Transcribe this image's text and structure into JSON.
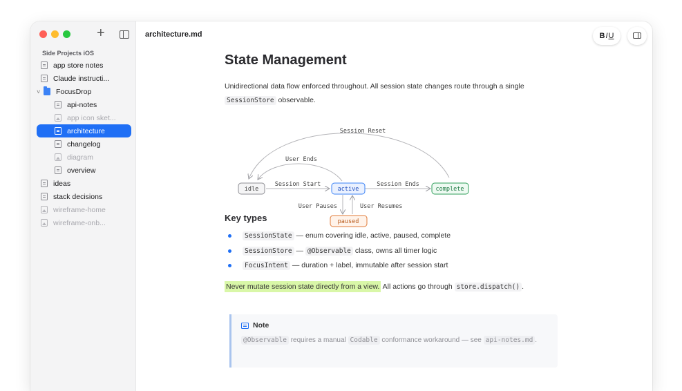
{
  "sidebar": {
    "section": "Side Projects iOS",
    "items": [
      {
        "label": "app store notes",
        "type": "doc",
        "indent": 0,
        "state": "normal"
      },
      {
        "label": "Claude instructi...",
        "type": "doc",
        "indent": 0,
        "state": "normal"
      },
      {
        "label": "FocusDrop",
        "type": "folder",
        "indent": 0,
        "state": "normal"
      },
      {
        "label": "api-notes",
        "type": "doc",
        "indent": 1,
        "state": "normal"
      },
      {
        "label": "app icon sket...",
        "type": "image",
        "indent": 1,
        "state": "dim"
      },
      {
        "label": "architecture",
        "type": "doc",
        "indent": 1,
        "state": "active"
      },
      {
        "label": "changelog",
        "type": "doc",
        "indent": 1,
        "state": "normal"
      },
      {
        "label": "diagram",
        "type": "image",
        "indent": 1,
        "state": "dim"
      },
      {
        "label": "overview",
        "type": "doc",
        "indent": 1,
        "state": "normal"
      },
      {
        "label": "ideas",
        "type": "doc",
        "indent": 0,
        "state": "normal"
      },
      {
        "label": "stack decisions",
        "type": "doc",
        "indent": 0,
        "state": "normal"
      },
      {
        "label": "wireframe-home",
        "type": "image",
        "indent": 0,
        "state": "dim"
      },
      {
        "label": "wireframe-onb...",
        "type": "image",
        "indent": 0,
        "state": "dim"
      }
    ]
  },
  "header": {
    "doc_title": "architecture.md",
    "format_b": "B",
    "format_i": "I",
    "format_u": "U"
  },
  "doc": {
    "h1": "State Management",
    "intro_1": "Unidirectional data flow enforced throughout. All session state changes route through a single",
    "intro_code": "SessionStore",
    "intro_2": " observable.",
    "diagram": {
      "states": {
        "idle": "idle",
        "active": "active",
        "complete": "complete",
        "paused": "paused"
      },
      "edges": {
        "reset": "Session Reset",
        "user_ends": "User Ends",
        "start": "Session Start",
        "ends": "Session Ends",
        "pauses": "User Pauses",
        "resumes": "User Resumes"
      }
    },
    "h2": "Key types",
    "key_types": [
      {
        "code": "SessionState",
        "sep": " — ",
        "text": "enum covering idle, active, paused, complete"
      },
      {
        "code": "SessionStore",
        "sep": " — ",
        "code2": "@Observable",
        "text": " class, owns all timer logic"
      },
      {
        "code": "FocusIntent",
        "sep": " — ",
        "text": "duration + label, immutable after session start"
      }
    ],
    "warning_highlight": "Never mutate session state directly from a view.",
    "warning_rest": " All actions go through ",
    "warning_code": "store.dispatch()",
    "warning_end": ".",
    "note": {
      "title": "Note",
      "code1": "@Observable",
      "t1": " requires a manual ",
      "code2": "Codable",
      "t2": " conformance workaround — see ",
      "code3": "api-notes.md",
      "t3": "."
    }
  },
  "colors": {
    "accent": "#1f6ff5",
    "active_fill": "#eaf1ff",
    "complete_stroke": "#2f9e5a",
    "paused_stroke": "#e07b39",
    "highlight": "#d9f7a8"
  }
}
